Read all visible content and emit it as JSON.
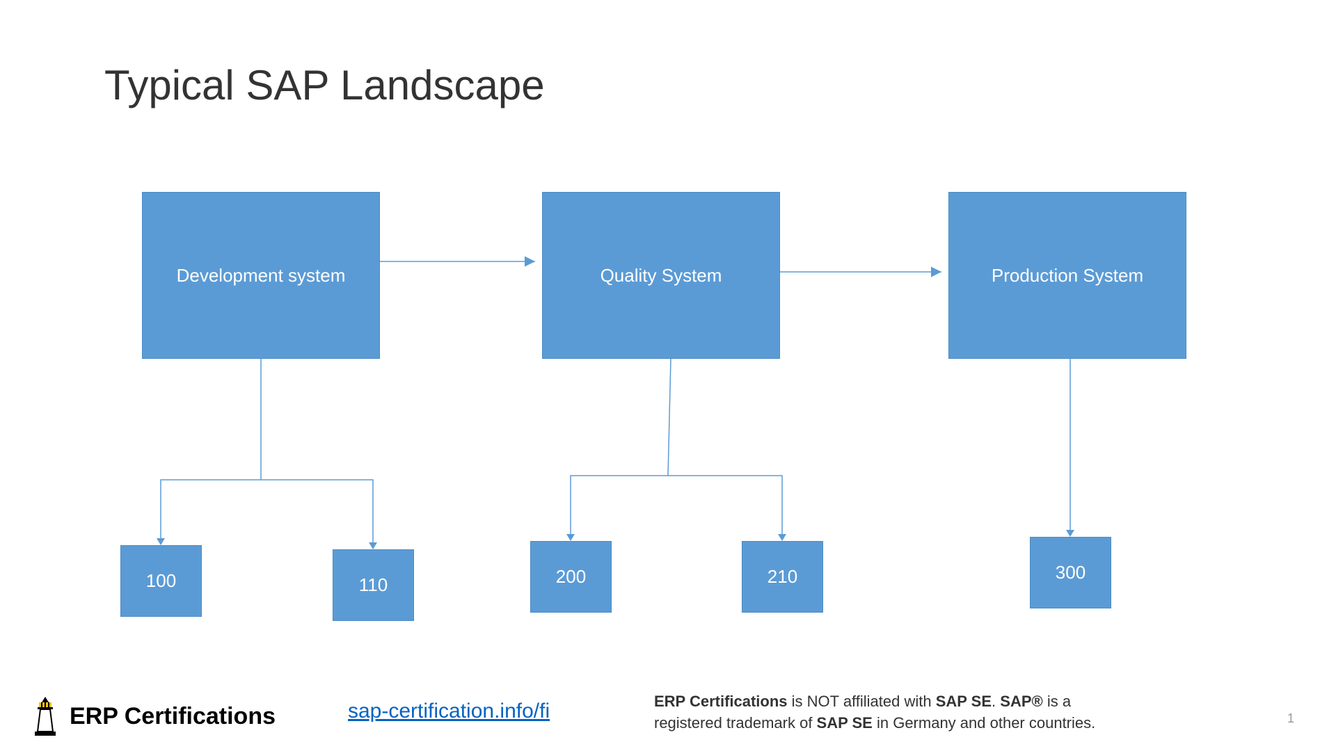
{
  "title": "Typical SAP Landscape",
  "systems": {
    "dev": {
      "label": "Development system"
    },
    "qa": {
      "label": "Quality System"
    },
    "prod": {
      "label": "Production System"
    }
  },
  "clients": {
    "c100": "100",
    "c110": "110",
    "c200": "200",
    "c210": "210",
    "c300": "300"
  },
  "footer": {
    "brand": "ERP Certifications",
    "link": "sap-certification.info/fi",
    "disclaimer_brand": "ERP Certifications",
    "disclaimer_text1": " is NOT affiliated with ",
    "disclaimer_sap1": "SAP SE",
    "disclaimer_dot": ". ",
    "disclaimer_sap2": "SAP®",
    "disclaimer_text2": " is a registered trademark of ",
    "disclaimer_sap3": "SAP SE",
    "disclaimer_text3": " in Germany and other countries.",
    "page": "1"
  },
  "colors": {
    "box": "#5b9bd5",
    "link": "#0563c1"
  }
}
